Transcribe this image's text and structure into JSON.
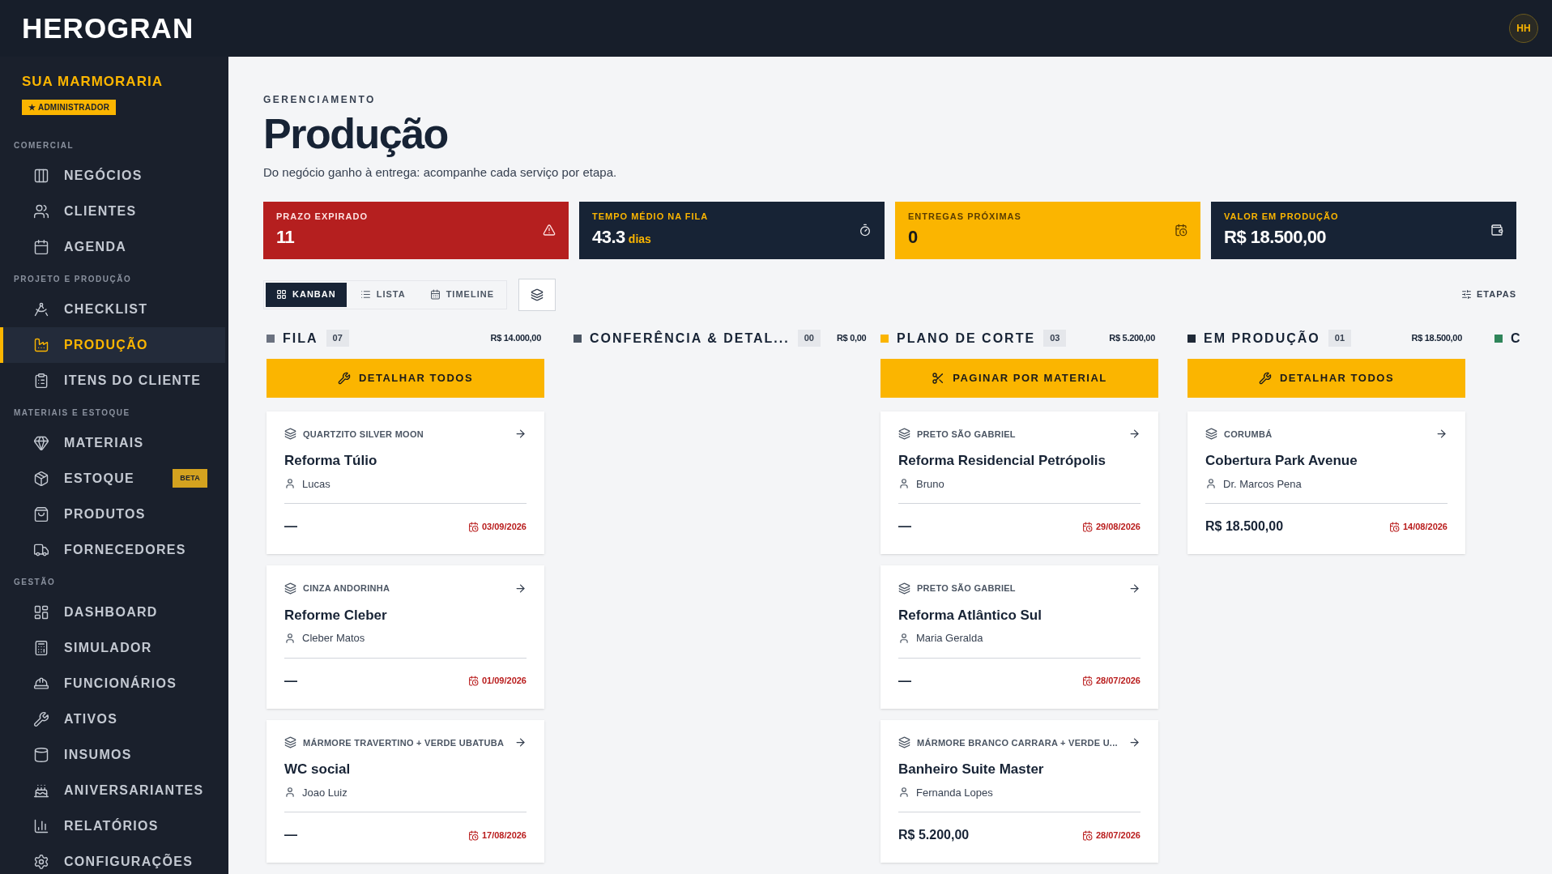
{
  "header": {
    "logo": "HEROGRAN",
    "avatar": "HH"
  },
  "sidebar": {
    "company": "SUA MARMORARIA",
    "role": "★ ADMINISTRADOR",
    "sections": [
      {
        "label": "COMERCIAL",
        "items": [
          {
            "label": "NEGÓCIOS",
            "selected": false
          },
          {
            "label": "CLIENTES",
            "selected": false
          },
          {
            "label": "AGENDA",
            "selected": false
          }
        ]
      },
      {
        "label": "PROJETO E PRODUÇÃO",
        "items": [
          {
            "label": "CHECKLIST",
            "selected": false
          },
          {
            "label": "PRODUÇÃO",
            "selected": true
          },
          {
            "label": "ITENS DO CLIENTE",
            "selected": false
          }
        ]
      },
      {
        "label": "MATERIAIS E ESTOQUE",
        "items": [
          {
            "label": "MATERIAIS",
            "selected": false
          },
          {
            "label": "ESTOQUE",
            "selected": false,
            "badge": "BETA"
          },
          {
            "label": "PRODUTOS",
            "selected": false
          },
          {
            "label": "FORNECEDORES",
            "selected": false
          }
        ]
      },
      {
        "label": "GESTÃO",
        "items": [
          {
            "label": "DASHBOARD",
            "selected": false
          },
          {
            "label": "SIMULADOR",
            "selected": false
          },
          {
            "label": "FUNCIONÁRIOS",
            "selected": false
          },
          {
            "label": "ATIVOS",
            "selected": false
          },
          {
            "label": "INSUMOS",
            "selected": false
          },
          {
            "label": "ANIVERSARIANTES",
            "selected": false
          },
          {
            "label": "RELATÓRIOS",
            "selected": false
          },
          {
            "label": "CONFIGURAÇÕES",
            "selected": false
          }
        ]
      }
    ]
  },
  "page": {
    "eyebrow": "GERENCIAMENTO",
    "title": "Produção",
    "subtitle": "Do negócio ganho à entrega: acompanhe cada serviço por etapa."
  },
  "stats": [
    {
      "kind": "danger",
      "label": "PRAZO EXPIRADO",
      "value": "11"
    },
    {
      "kind": "dark",
      "label": "TEMPO MÉDIO NA FILA",
      "value": "43.3",
      "unit": "dias"
    },
    {
      "kind": "warning",
      "label": "ENTREGAS PRÓXIMAS",
      "value": "0"
    },
    {
      "kind": "dark",
      "label": "VALOR EM PRODUÇÃO",
      "value": "R$ 18.500,00"
    }
  ],
  "views": [
    {
      "label": "KANBAN",
      "selected": true
    },
    {
      "label": "LISTA",
      "selected": false
    },
    {
      "label": "TIMELINE",
      "selected": false
    }
  ],
  "stages_button": "ETAPAS",
  "columns": [
    {
      "title": "FILA",
      "color": "#6b7280",
      "count": "07",
      "total": "R$ 14.000,00",
      "action": {
        "kind": "detail",
        "label": "DETALHAR TODOS"
      },
      "cards": [
        {
          "material": "QUARTZITO SILVER MOON",
          "title": "Reforma Túlio",
          "client": "Lucas",
          "value": "—",
          "date": "03/09/2026"
        },
        {
          "material": "CINZA ANDORINHA",
          "title": "Reforme Cleber",
          "client": "Cleber Matos",
          "value": "—",
          "date": "01/09/2026"
        },
        {
          "material": "MÁRMORE TRAVERTINO + VERDE UBATUBA",
          "title": "WC social",
          "client": "Joao Luiz",
          "value": "—",
          "date": "17/08/2026"
        }
      ]
    },
    {
      "title": "CONFERÊNCIA & DETAL...",
      "color": "#4b5563",
      "count": "00",
      "total": "R$ 0,00"
    },
    {
      "title": "PLANO DE CORTE",
      "color": "#fbb500",
      "count": "03",
      "total": "R$ 5.200,00",
      "action": {
        "kind": "cut",
        "label": "PAGINAR POR MATERIAL"
      },
      "cards": [
        {
          "material": "PRETO SÃO GABRIEL",
          "title": "Reforma Residencial Petrópolis",
          "client": "Bruno",
          "value": "—",
          "date": "29/08/2026"
        },
        {
          "material": "PRETO SÃO GABRIEL",
          "title": "Reforma Atlântico Sul",
          "client": "Maria Geralda",
          "value": "—",
          "date": "28/07/2026"
        },
        {
          "material": "MÁRMORE BRANCO CARRARA + VERDE U...",
          "title": "Banheiro Suite Master",
          "client": "Fernanda Lopes",
          "value": "R$ 5.200,00",
          "date": "28/07/2026"
        }
      ]
    },
    {
      "title": "EM PRODUÇÃO",
      "color": "#1f2937",
      "count": "01",
      "total": "R$ 18.500,00",
      "action": {
        "kind": "detail",
        "label": "DETALHAR TODOS"
      },
      "cards": [
        {
          "material": "CORUMBÁ",
          "title": "Cobertura Park Avenue",
          "client": "Dr. Marcos Pena",
          "value": "R$ 18.500,00",
          "date": "14/08/2026"
        }
      ]
    },
    {
      "title": "C",
      "color": "#2f855a"
    }
  ]
}
